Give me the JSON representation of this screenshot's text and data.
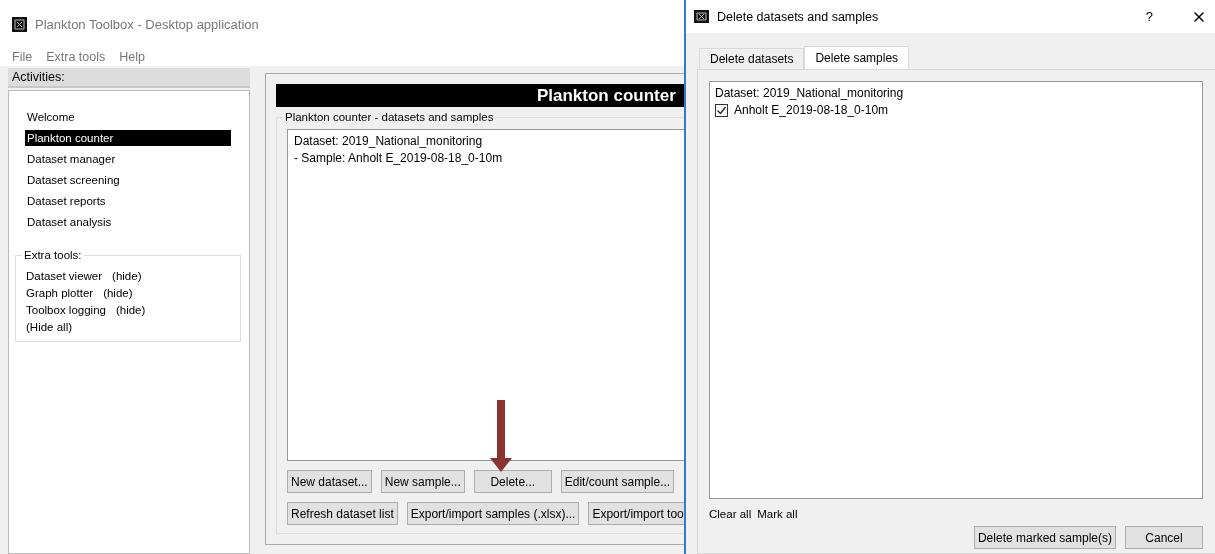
{
  "window": {
    "title": "Plankton Toolbox - Desktop application"
  },
  "menu": [
    "File",
    "Extra tools",
    "Help"
  ],
  "activities": {
    "title": "Activities:",
    "items": [
      {
        "label": "Welcome",
        "selected": false
      },
      {
        "label": "Plankton counter",
        "selected": true
      },
      {
        "label": "Dataset manager",
        "selected": false
      },
      {
        "label": "Dataset screening",
        "selected": false
      },
      {
        "label": "Dataset reports",
        "selected": false
      },
      {
        "label": "Dataset analysis",
        "selected": false
      }
    ]
  },
  "extra_tools": {
    "title": "Extra tools:",
    "items": [
      {
        "label": "Dataset viewer",
        "action": "(hide)"
      },
      {
        "label": "Graph plotter",
        "action": "(hide)"
      },
      {
        "label": "Toolbox logging",
        "action": "(hide)"
      }
    ],
    "hide_all": "(Hide all)"
  },
  "main": {
    "header": "Plankton counter",
    "group_title": "Plankton counter - datasets and samples",
    "list": [
      "Dataset: 2019_National_monitoring",
      "- Sample: Anholt E_2019-08-18_0-10m"
    ],
    "button_rows": [
      [
        "New dataset...",
        "New sample...",
        "Delete...",
        "Edit/count sample..."
      ],
      [
        "Refresh dataset list",
        "Export/import samples (.xlsx)...",
        "Export/import too"
      ]
    ]
  },
  "dialog": {
    "title": "Delete datasets and samples",
    "help": "?",
    "tabs": [
      {
        "label": "Delete datasets",
        "selected": false
      },
      {
        "label": "Delete samples",
        "selected": true
      }
    ],
    "dataset": "Dataset: 2019_National_monitoring",
    "samples": [
      {
        "label": "Anholt E_2019-08-18_0-10m",
        "checked": true
      }
    ],
    "links": [
      "Clear all",
      "Mark all"
    ],
    "buttons": [
      "Delete marked sample(s)",
      "Cancel"
    ]
  }
}
